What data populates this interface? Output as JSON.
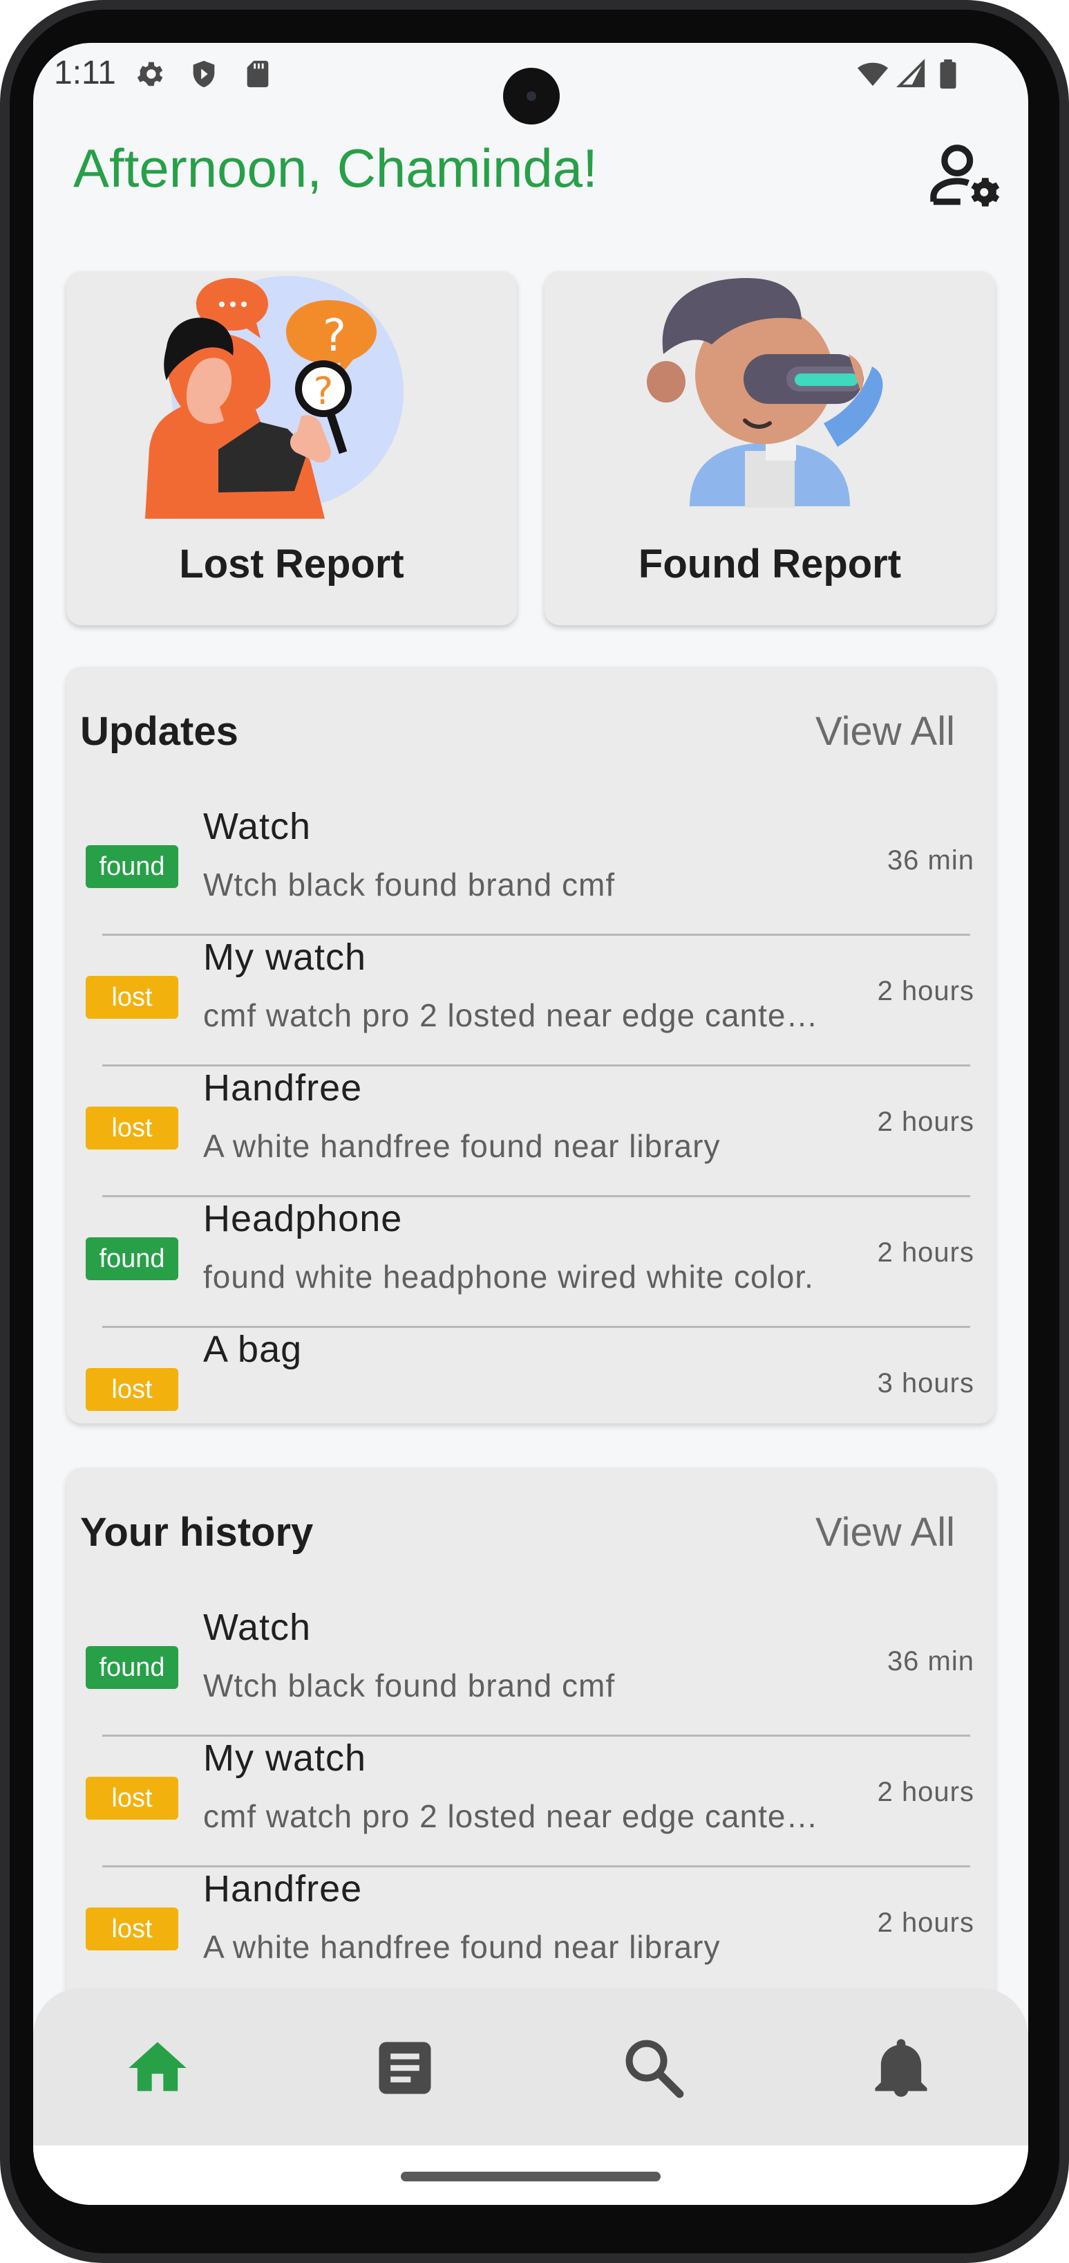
{
  "status_bar": {
    "time": "1:11",
    "left_icons": [
      "gear-icon",
      "shield-icon",
      "sd-card-icon"
    ],
    "right_icons": [
      "wifi-icon",
      "cell-signal-icon",
      "battery-icon"
    ]
  },
  "header": {
    "greeting": "Afternoon, Chaminda!",
    "profile_icon": "user-settings-icon",
    "greeting_color": "#27a048"
  },
  "report_cards": [
    {
      "label": "Lost Report",
      "illustration": "woman-with-magnifier-illustration"
    },
    {
      "label": "Found Report",
      "illustration": "boy-with-vr-headset-illustration"
    }
  ],
  "updates": {
    "title": "Updates",
    "view_all": "View All",
    "items": [
      {
        "status": "found",
        "title": "Watch",
        "description": "Wtch black found brand cmf",
        "time": "36 min"
      },
      {
        "status": "lost",
        "title": "My watch",
        "description": "cmf watch pro 2 losted near edge cante…",
        "time": "2 hours"
      },
      {
        "status": "lost",
        "title": "Handfree",
        "description": "A white handfree found near library",
        "time": "2 hours"
      },
      {
        "status": "found",
        "title": "Headphone",
        "description": "found white headphone wired white color.",
        "time": "2 hours"
      },
      {
        "status": "lost",
        "title": "A bag",
        "description": "",
        "time": "3 hours"
      }
    ]
  },
  "history": {
    "title": "Your history",
    "view_all": "View All",
    "items": [
      {
        "status": "found",
        "title": "Watch",
        "description": "Wtch black found brand cmf",
        "time": "36 min"
      },
      {
        "status": "lost",
        "title": "My watch",
        "description": "cmf watch pro 2 losted near edge cante…",
        "time": "2 hours"
      },
      {
        "status": "lost",
        "title": "Handfree",
        "description": "A white handfree found near library",
        "time": "2 hours"
      }
    ]
  },
  "bottom_nav": [
    {
      "icon": "home-icon",
      "active": true
    },
    {
      "icon": "document-icon",
      "active": false
    },
    {
      "icon": "search-icon",
      "active": false
    },
    {
      "icon": "bell-icon",
      "active": false
    }
  ],
  "colors": {
    "accent": "#27a048",
    "found_badge": "#27a048",
    "lost_badge": "#f2b10c",
    "card_bg": "#ebebeb",
    "screen_bg": "#f6f7f9"
  }
}
